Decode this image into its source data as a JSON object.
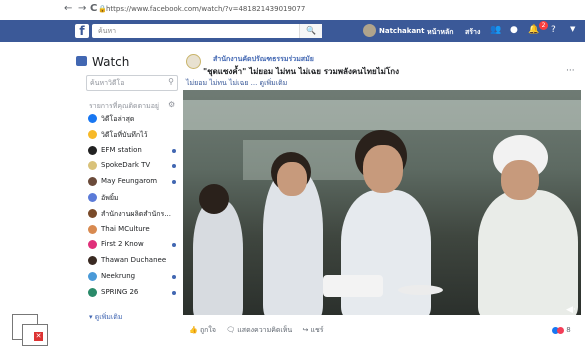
{
  "browser": {
    "back": "←",
    "forward": "→",
    "reload": "C",
    "lock": "🔒",
    "url": "https://www.facebook.com/watch/?v=481821439019077"
  },
  "fb": {
    "logo": "f",
    "search_placeholder": "ค้นหา",
    "search_button": "🔍",
    "user_name": "Natchakant",
    "home": "หน้าหลัก",
    "create": "สร้าง",
    "notif_count": "2"
  },
  "sidebar": {
    "title": "Watch",
    "search_placeholder": "ค้นหาวิดีโอ",
    "section_title": "รายการที่คุณติดตามอยู่",
    "items": [
      {
        "label": "วิดีโอล่าสุด",
        "color": "#1877f2",
        "new": false
      },
      {
        "label": "วิดีโอที่บันทึกไว้",
        "color": "#f7b928",
        "new": false
      },
      {
        "label": "EFM station",
        "color": "#222222",
        "new": true
      },
      {
        "label": "SpokeDark TV",
        "color": "#d9c27a",
        "new": true
      },
      {
        "label": "May Feungarom",
        "color": "#6b4b3a",
        "new": true
      },
      {
        "label": "อัพยิ้ม",
        "color": "#5b7bd8",
        "new": false
      },
      {
        "label": "สำนักงานผลิตสำนักร...",
        "color": "#7a4b2a",
        "new": false
      },
      {
        "label": "Thai MCulture",
        "color": "#d88a50",
        "new": false
      },
      {
        "label": "First 2 Know",
        "color": "#e0307a",
        "new": true
      },
      {
        "label": "Thawan Duchanee",
        "color": "#3a2a22",
        "new": false
      },
      {
        "label": "Neekrung",
        "color": "#4a9ad8",
        "new": true
      },
      {
        "label": "SPRING 26",
        "color": "#2a8a6a",
        "new": true
      }
    ],
    "see_more": "▾ ดูเพิ่มเติม"
  },
  "post": {
    "page_name": "สำนักงานคัดปรัณฑธรรมร่วมสมัย",
    "title": "\"ชุดแซงค้ำ\" ไม่ยอม ไม่ทน ไม่เฉย รวมพลังคนไทยไม่โกง",
    "subtitle": "ไม่ยอม ไม่ทน ไม่เฉย ... ดูเพิ่มเติม",
    "more": "···",
    "volume": "◀·",
    "like": "👍 ถูกใจ",
    "comment": "🗨 แสดงความคิดเห็น",
    "share": "↪ แชร์",
    "reaction_count": "8"
  }
}
